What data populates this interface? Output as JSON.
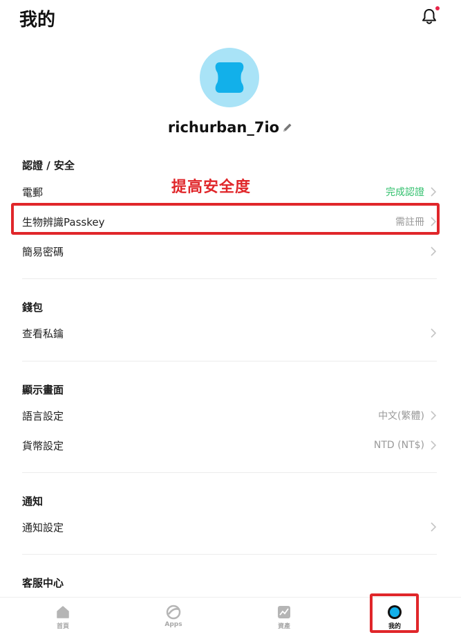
{
  "header": {
    "title": "我的"
  },
  "profile": {
    "username": "richurban_7io"
  },
  "annotation": {
    "text": "提高安全度"
  },
  "sections": {
    "security": {
      "title": "認證 / 安全",
      "rows": [
        {
          "label": "電郵",
          "value": "完成認證"
        },
        {
          "label": "生物辨識Passkey",
          "value": "需註冊"
        },
        {
          "label": "簡易密碼",
          "value": ""
        }
      ]
    },
    "wallet": {
      "title": "錢包",
      "rows": [
        {
          "label": "查看私鑰",
          "value": ""
        }
      ]
    },
    "display": {
      "title": "顯示畫面",
      "rows": [
        {
          "label": "語言設定",
          "value": "中文(繁體)"
        },
        {
          "label": "貨幣設定",
          "value": "NTD (NT$)"
        }
      ]
    },
    "notify": {
      "title": "通知",
      "rows": [
        {
          "label": "通知設定",
          "value": ""
        }
      ]
    },
    "support": {
      "title": "客服中心"
    }
  },
  "bottom_nav": [
    {
      "label": "首頁",
      "icon": "home-icon"
    },
    {
      "label": "Apps",
      "icon": "apps-icon"
    },
    {
      "label": "資產",
      "icon": "assets-chart-icon"
    },
    {
      "label": "我的",
      "icon": "profile-icon",
      "active": true
    }
  ],
  "colors": {
    "accent_green": "#2fbf6b",
    "annotation_red": "#e0262a",
    "avatar_bg": "#a9e3f7",
    "avatar_fg": "#12b0ea",
    "notification_dot": "#e8254a"
  }
}
